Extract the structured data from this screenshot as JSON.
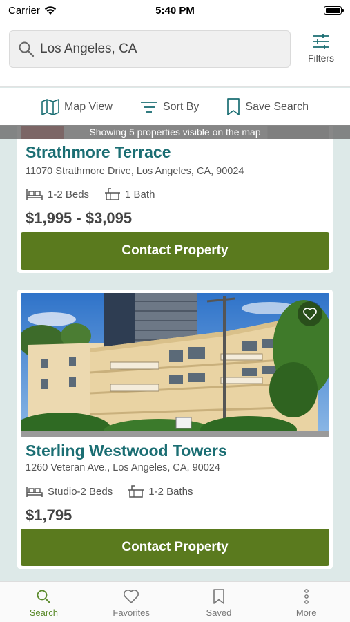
{
  "status_bar": {
    "carrier": "Carrier",
    "time": "5:40 PM"
  },
  "header": {
    "search_value": "Los Angeles, CA",
    "filters_label": "Filters"
  },
  "actions": {
    "map_view": "Map View",
    "sort_by": "Sort By",
    "save_search": "Save Search"
  },
  "banner": "Showing 5 properties visible on the map",
  "listings": [
    {
      "name": "Strathmore Terrace",
      "address": "11070 Strathmore Drive, Los Angeles, CA, 90024",
      "beds": "1-2 Beds",
      "baths": "1 Bath",
      "price": "$1,995 - $3,095",
      "cta": "Contact Property"
    },
    {
      "name": "Sterling Westwood Towers",
      "address": "1260 Veteran Ave., Los Angeles, CA, 90024",
      "beds": "Studio-2 Beds",
      "baths": "1-2 Baths",
      "price": "$1,795",
      "cta": "Contact Property"
    }
  ],
  "tabs": [
    {
      "label": "Search",
      "icon": "search-icon",
      "active": true
    },
    {
      "label": "Favorites",
      "icon": "heart-icon",
      "active": false
    },
    {
      "label": "Saved",
      "icon": "bookmark-icon",
      "active": false
    },
    {
      "label": "More",
      "icon": "more-vertical-icon",
      "active": false
    }
  ],
  "colors": {
    "accent_green": "#5a7a1e",
    "title_teal": "#1b6e73",
    "page_bg": "#dde9e8"
  }
}
